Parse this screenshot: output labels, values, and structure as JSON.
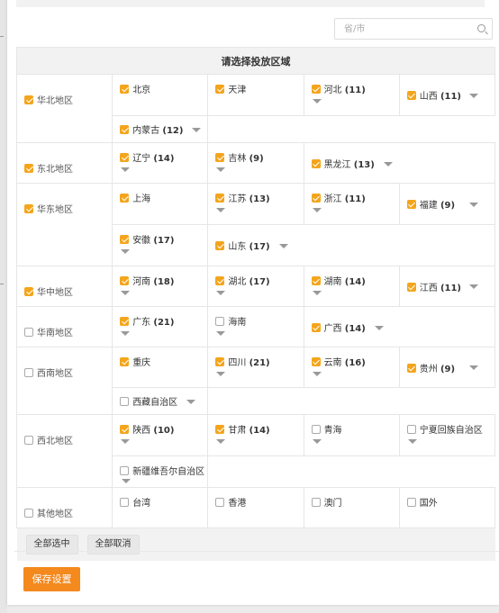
{
  "search": {
    "placeholder": "省/市"
  },
  "table_title": "请选择投放区域",
  "colors": {
    "accent": "#f4a51c",
    "save_button": "#f4891e"
  },
  "regions": [
    {
      "name": "华北地区",
      "checked": true,
      "rows": [
        [
          {
            "name": "北京",
            "count": null,
            "checked": true,
            "arrow": "none"
          },
          {
            "name": "天津",
            "count": null,
            "checked": true,
            "arrow": "none"
          },
          {
            "name": "河北",
            "count": "(11)",
            "checked": true,
            "arrow": "below"
          },
          {
            "name": "山西",
            "count": "(11)",
            "checked": true,
            "arrow": "far"
          }
        ],
        [
          {
            "name": "内蒙古",
            "count": "(12)",
            "checked": true,
            "arrow": "inline"
          }
        ]
      ]
    },
    {
      "name": "东北地区",
      "checked": true,
      "rows": [
        [
          {
            "name": "辽宁",
            "count": "(14)",
            "checked": true,
            "arrow": "below"
          },
          {
            "name": "吉林",
            "count": "(9)",
            "checked": true,
            "arrow": "below"
          },
          {
            "name": "黑龙江",
            "count": "(13)",
            "checked": true,
            "arrow": "inline",
            "span": 2
          }
        ]
      ]
    },
    {
      "name": "华东地区",
      "checked": true,
      "rows": [
        [
          {
            "name": "上海",
            "count": null,
            "checked": true,
            "arrow": "none"
          },
          {
            "name": "江苏",
            "count": "(13)",
            "checked": true,
            "arrow": "below"
          },
          {
            "name": "浙江",
            "count": "(11)",
            "checked": true,
            "arrow": "below"
          },
          {
            "name": "福建",
            "count": "(9)",
            "checked": true,
            "arrow": "far"
          }
        ],
        [
          {
            "name": "安徽",
            "count": "(17)",
            "checked": true,
            "arrow": "below"
          },
          {
            "name": "山东",
            "count": "(17)",
            "checked": true,
            "arrow": "inline",
            "span": 3
          }
        ]
      ]
    },
    {
      "name": "华中地区",
      "checked": true,
      "rows": [
        [
          {
            "name": "河南",
            "count": "(18)",
            "checked": true,
            "arrow": "below"
          },
          {
            "name": "湖北",
            "count": "(17)",
            "checked": true,
            "arrow": "below"
          },
          {
            "name": "湖南",
            "count": "(14)",
            "checked": true,
            "arrow": "below"
          },
          {
            "name": "江西",
            "count": "(11)",
            "checked": true,
            "arrow": "far"
          }
        ]
      ]
    },
    {
      "name": "华南地区",
      "checked": false,
      "rows": [
        [
          {
            "name": "广东",
            "count": "(21)",
            "checked": true,
            "arrow": "below"
          },
          {
            "name": "海南",
            "count": null,
            "checked": false,
            "arrow": "below"
          },
          {
            "name": "广西",
            "count": "(14)",
            "checked": true,
            "arrow": "inline",
            "span": 2
          }
        ]
      ]
    },
    {
      "name": "西南地区",
      "checked": false,
      "rows": [
        [
          {
            "name": "重庆",
            "count": null,
            "checked": true,
            "arrow": "none"
          },
          {
            "name": "四川",
            "count": "(21)",
            "checked": true,
            "arrow": "below"
          },
          {
            "name": "云南",
            "count": "(16)",
            "checked": true,
            "arrow": "below"
          },
          {
            "name": "贵州",
            "count": "(9)",
            "checked": true,
            "arrow": "far"
          }
        ],
        [
          {
            "name": "西藏自治区",
            "count": null,
            "checked": false,
            "arrow": "inline"
          }
        ]
      ]
    },
    {
      "name": "西北地区",
      "checked": false,
      "rows": [
        [
          {
            "name": "陕西",
            "count": "(10)",
            "checked": true,
            "arrow": "below"
          },
          {
            "name": "甘肃",
            "count": "(14)",
            "checked": true,
            "arrow": "below"
          },
          {
            "name": "青海",
            "count": null,
            "checked": false,
            "arrow": "below"
          },
          {
            "name": "宁夏回族自治区",
            "count": null,
            "checked": false,
            "arrow": "below"
          }
        ],
        [
          {
            "name": "新疆维吾尔自治区",
            "count": null,
            "checked": false,
            "arrow": "inline-tight"
          }
        ]
      ]
    },
    {
      "name": "其他地区",
      "checked": false,
      "rows": [
        [
          {
            "name": "台湾",
            "count": null,
            "checked": false,
            "arrow": "none"
          },
          {
            "name": "香港",
            "count": null,
            "checked": false,
            "arrow": "none"
          },
          {
            "name": "澳门",
            "count": null,
            "checked": false,
            "arrow": "none"
          },
          {
            "name": "国外",
            "count": null,
            "checked": false,
            "arrow": "none"
          }
        ]
      ]
    }
  ],
  "buttons": {
    "select_all": "全部选中",
    "deselect_all": "全部取消",
    "save": "保存设置"
  }
}
